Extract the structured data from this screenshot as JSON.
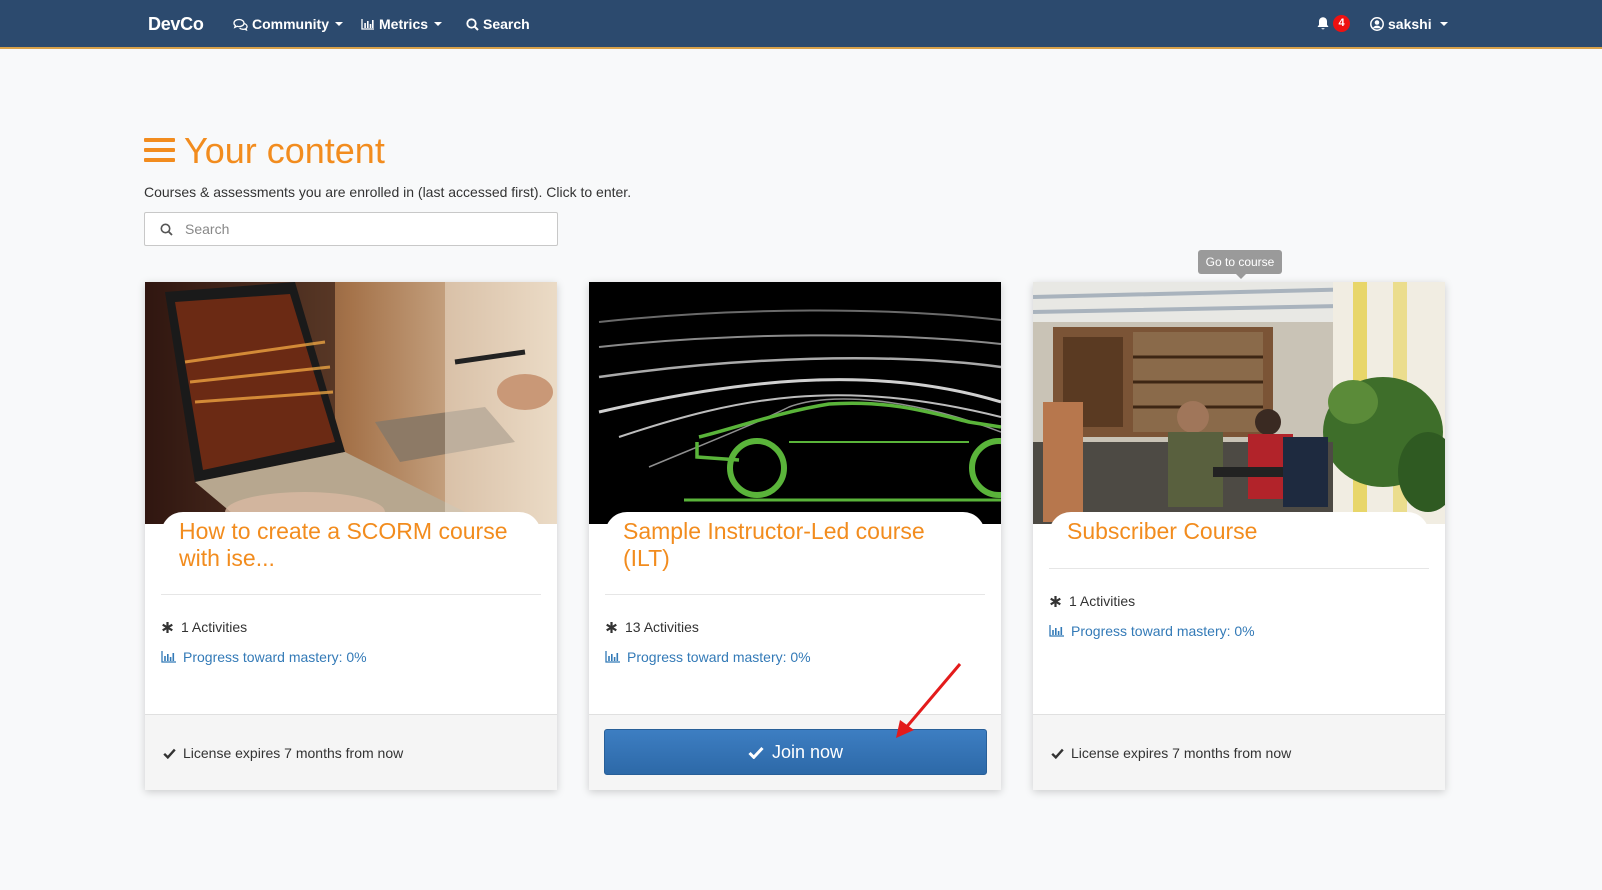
{
  "navbar": {
    "brand": "DevCo",
    "community_label": "Community",
    "metrics_label": "Metrics",
    "search_label": "Search",
    "notification_count": "4",
    "username": "sakshi"
  },
  "header": {
    "title": "Your content",
    "subtitle": "Courses & assessments you are enrolled in (last accessed first). Click to enter.",
    "search_placeholder": "Search"
  },
  "tooltip": "Go to course",
  "cards": [
    {
      "title": "How to create a SCORM course with ise...",
      "activities": "1 Activities",
      "progress": "Progress toward mastery: 0%",
      "footer": "License expires 7 months from now"
    },
    {
      "title": "Sample Instructor-Led course (ILT)",
      "activities": "13 Activities",
      "progress": "Progress toward mastery: 0%",
      "join_label": "Join now"
    },
    {
      "title": "Subscriber Course",
      "activities": "1 Activities",
      "progress": "Progress toward mastery: 0%",
      "footer": "License expires 7 months from now"
    }
  ],
  "colors": {
    "navbar": "#2c4a6e",
    "accent": "#f28c1e",
    "link": "#337ab7",
    "button": "#2d69a8",
    "annotation_arrow": "#e31b1b"
  },
  "icons": [
    "comments-icon",
    "bar-chart-icon",
    "search-icon",
    "bell-icon",
    "user-circle-icon",
    "hamburger-icon",
    "asterisk-icon",
    "check-icon",
    "arrow-annotation"
  ]
}
